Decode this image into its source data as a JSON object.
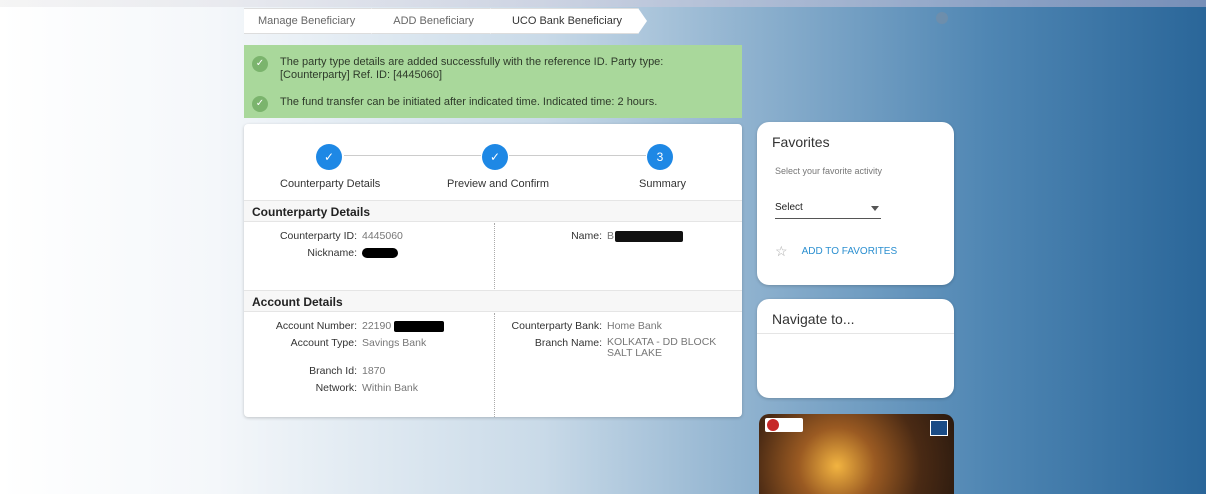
{
  "breadcrumb": [
    "Manage Beneficiary",
    "ADD Beneficiary",
    "UCO Bank Beneficiary"
  ],
  "alerts": [
    "The party type details are added successfully with the reference ID. Party type: [Counterparty] Ref. ID: [4445060]",
    "The fund transfer can be initiated after indicated time. Indicated time: 2 hours."
  ],
  "stepper": {
    "steps": [
      {
        "label": "Counterparty Details",
        "icon": "check-icon",
        "status": "done"
      },
      {
        "label": "Preview and Confirm",
        "icon": "check-icon",
        "status": "done"
      },
      {
        "label": "Summary",
        "number": "3",
        "status": "current"
      }
    ]
  },
  "counterparty": {
    "heading": "Counterparty Details",
    "id_label": "Counterparty ID:",
    "id_value": "4445060",
    "nickname_label": "Nickname:",
    "name_label": "Name:",
    "name_value": "B"
  },
  "account": {
    "heading": "Account Details",
    "number_label": "Account Number:",
    "number_value": "22190",
    "type_label": "Account Type:",
    "type_value": "Savings Bank",
    "branch_id_label": "Branch Id:",
    "branch_id_value": "1870",
    "network_label": "Network:",
    "network_value": "Within Bank",
    "bank_label": "Counterparty Bank:",
    "bank_value": "Home Bank",
    "branch_name_label": "Branch Name:",
    "branch_name_value": "KOLKATA - DD BLOCK SALT LAKE"
  },
  "favorites": {
    "title": "Favorites",
    "subtitle": "Select your favorite activity",
    "select_value": "Select",
    "add_label": "ADD TO FAVORITES"
  },
  "navigate": {
    "title": "Navigate to..."
  },
  "colors": {
    "success_bg": "#a9d89b",
    "step_blue": "#1e88e5",
    "link_blue": "#2b8fd0"
  }
}
